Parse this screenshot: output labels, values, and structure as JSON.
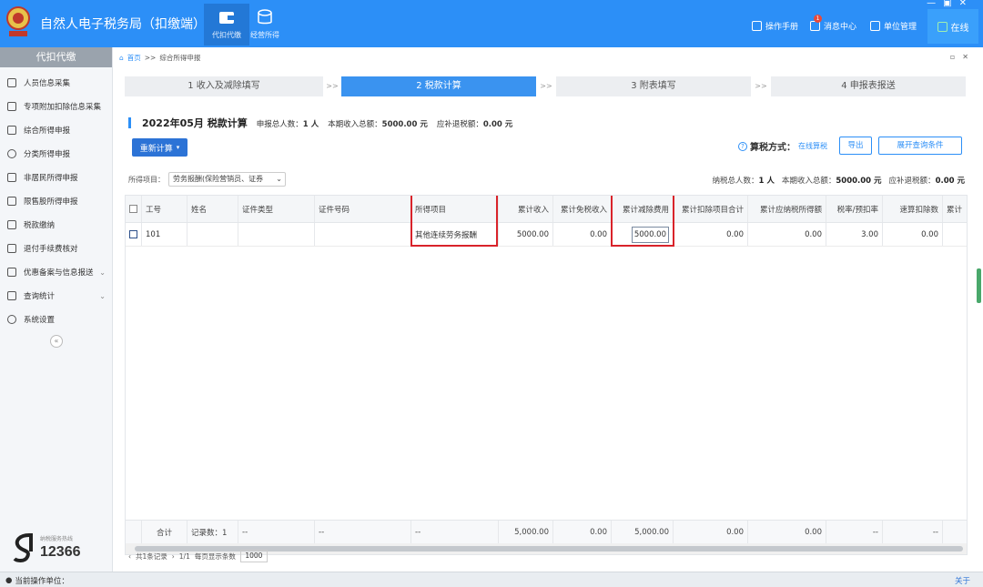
{
  "app": {
    "title": "自然人电子税务局（扣缴端）",
    "window_controls": [
      "—",
      "▣",
      "✕"
    ]
  },
  "topnav": [
    {
      "label": "代扣代缴",
      "icon": "wallet-icon",
      "active": true
    },
    {
      "label": "经营所得",
      "icon": "coins-icon",
      "active": false
    }
  ],
  "topright": {
    "manual": "操作手册",
    "messages": "消息中心",
    "messages_badge": "1",
    "org": "单位管理",
    "online": "在线"
  },
  "sidebar": {
    "header": "代扣代缴",
    "items": [
      {
        "label": "人员信息采集",
        "icon": "person-icon"
      },
      {
        "label": "专项附加扣除信息采集",
        "icon": "list-icon"
      },
      {
        "label": "综合所得申报",
        "icon": "layers-icon"
      },
      {
        "label": "分类所得申报",
        "icon": "clock-icon"
      },
      {
        "label": "非居民所得申报",
        "icon": "person-outline-icon"
      },
      {
        "label": "限售股所得申报",
        "icon": "chart-icon"
      },
      {
        "label": "税款缴纳",
        "icon": "folder-icon"
      },
      {
        "label": "退付手续费核对",
        "icon": "receipt-icon"
      },
      {
        "label": "优惠备案与信息报送",
        "icon": "document-icon",
        "expandable": true
      },
      {
        "label": "查询统计",
        "icon": "search-list-icon",
        "expandable": true
      },
      {
        "label": "系统设置",
        "icon": "gear-icon"
      }
    ],
    "collapse": "«",
    "hotline_label": "纳税服务热线",
    "hotline": "12366"
  },
  "breadcrumb": {
    "home": "首页",
    "sep": ">>",
    "current": "综合所得申报"
  },
  "crumb_controls": [
    "▫",
    "✕"
  ],
  "steps": [
    {
      "label": "1 收入及减除填写",
      "active": false
    },
    {
      "label": "2 税款计算",
      "active": true
    },
    {
      "label": "3 附表填写",
      "active": false
    },
    {
      "label": "4 申报表报送",
      "active": false
    }
  ],
  "step_sep": ">>",
  "summary": {
    "period_title": "2022年05月 税款计算",
    "declare_label": "申报总人数：",
    "declare_value": "1 人",
    "income_label": "本期收入总额：",
    "income_value": "5000.00 元",
    "refund_label": "应补退税额：",
    "refund_value": "0.00 元"
  },
  "actions": {
    "recalc": "重新计算",
    "calc_mode_label": "算税方式：",
    "calc_mode_value": "在线算税",
    "export": "导出",
    "expand_query": "展开查询条件"
  },
  "filter": {
    "label": "所得项目：",
    "value": "劳务报酬(保险营销员、证券"
  },
  "stats": {
    "taxpayers_label": "纳税总人数：",
    "taxpayers": "1 人",
    "income_label": "本期收入总额：",
    "income": "5000.00 元",
    "refund_label": "应补退税额：",
    "refund": "0.00 元"
  },
  "table": {
    "headers": [
      "工号",
      "姓名",
      "证件类型",
      "证件号码",
      "所得项目",
      "累计收入",
      "累计免税收入",
      "累计减除费用",
      "累计扣除项目合计",
      "累计应纳税所得额",
      "税率/预扣率",
      "速算扣除数",
      "累计"
    ],
    "rows": [
      [
        "101",
        "",
        "",
        "",
        "其他连续劳务报酬",
        "5000.00",
        "0.00",
        "5000.00",
        "0.00",
        "0.00",
        "3.00",
        "0.00",
        ""
      ]
    ],
    "footer": [
      "合计",
      "记录数：1",
      "--",
      "--",
      "--",
      "5,000.00",
      "0.00",
      "5,000.00",
      "0.00",
      "0.00",
      "--",
      "--",
      ""
    ]
  },
  "pager": {
    "total": "共1条记录",
    "page": "1/1",
    "page_size_label": "每页显示条数",
    "page_size": "1000"
  },
  "status": {
    "org_label": "当前操作单位：",
    "close": "关于"
  }
}
